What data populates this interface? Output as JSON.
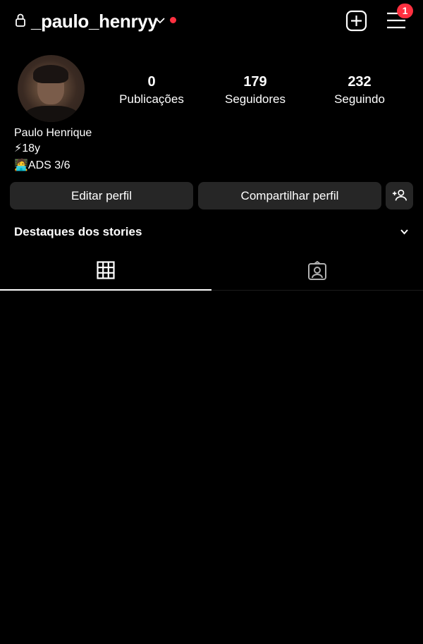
{
  "header": {
    "username": "_paulo_henryy",
    "notification_count": "1"
  },
  "stats": [
    {
      "value": "0",
      "label": "Publicações"
    },
    {
      "value": "179",
      "label": "Seguidores"
    },
    {
      "value": "232",
      "label": "Seguindo"
    }
  ],
  "bio": {
    "name": "Paulo Henrique",
    "line1": "⚡18y",
    "line2": "🧑‍💻ADS 3/6"
  },
  "actions": {
    "edit_label": "Editar perfil",
    "share_label": "Compartilhar perfil"
  },
  "highlights": {
    "title": "Destaques dos stories"
  },
  "tabs": [
    {
      "icon": "grid-icon",
      "active": true
    },
    {
      "icon": "tagged-icon",
      "active": false
    }
  ],
  "colors": {
    "background": "#000000",
    "button": "#262626",
    "accent_red": "#ff3040",
    "text": "#ffffff"
  }
}
